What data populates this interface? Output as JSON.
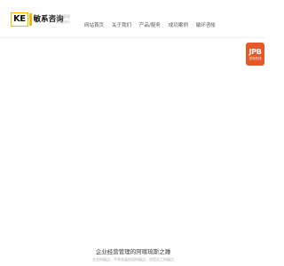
{
  "header": {
    "logo": {
      "mark": "KE",
      "text": "敏系咨询"
    },
    "tagline": [
      "咨询管理",
      "高效执行"
    ],
    "nav": [
      {
        "label": "网站首页"
      },
      {
        "label": "关于我们"
      },
      {
        "label": "产品/服务"
      },
      {
        "label": "成功案例"
      },
      {
        "label": "敏环咨帐"
      }
    ]
  },
  "badge": {
    "label": "JPB",
    "sub": "咨询热线"
  },
  "footer": {
    "title": "企业经营管理的阿喀琉斯之踵",
    "subtitle": "企业的痛点，不同发展阶段的痛点，也是员工的痛点"
  },
  "colors": {
    "accent": "#ffb400",
    "badge": "#e55a2b"
  }
}
